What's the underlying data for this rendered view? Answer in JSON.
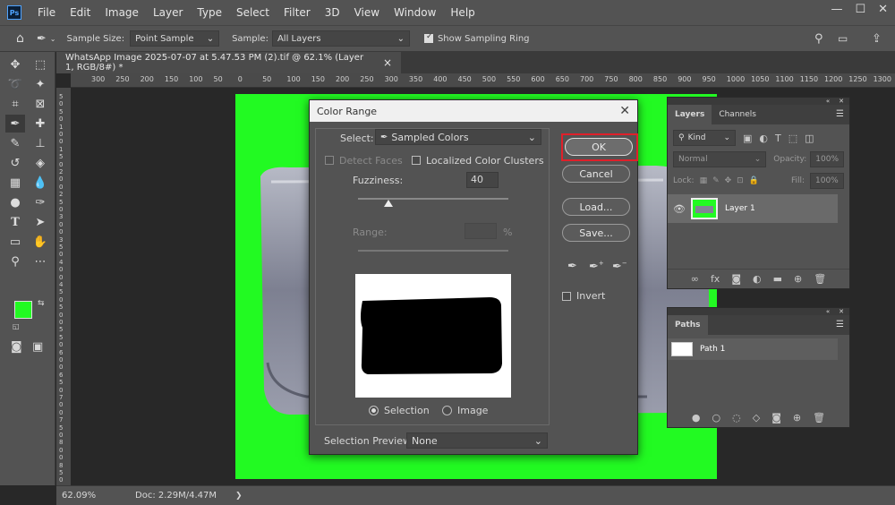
{
  "menubar": {
    "logo": "Ps",
    "items": [
      "File",
      "Edit",
      "Image",
      "Layer",
      "Type",
      "Select",
      "Filter",
      "3D",
      "View",
      "Window",
      "Help"
    ],
    "win_min": "—",
    "win_max": "☐",
    "win_close": "✕"
  },
  "options": {
    "sample_size_label": "Sample Size:",
    "sample_size_value": "Point Sample",
    "sample_label": "Sample:",
    "sample_value": "All Layers",
    "show_ring_label": "Show Sampling Ring"
  },
  "doc": {
    "tab_title": "WhatsApp Image 2025-07-07 at 5.47.53 PM (2).tif @ 62.1% (Layer 1, RGB/8#) *",
    "tab_close": "×"
  },
  "ruler": {
    "top": [
      "300",
      "250",
      "200",
      "150",
      "100",
      "50",
      "0",
      "50",
      "100",
      "150",
      "200",
      "250",
      "300",
      "350",
      "400",
      "450",
      "500",
      "550",
      "600",
      "650",
      "700",
      "750",
      "800",
      "850",
      "900",
      "950",
      "1000",
      "1050",
      "1100",
      "1150",
      "1200",
      "1250",
      "1300"
    ],
    "left": [
      "5",
      "0",
      "5",
      "0",
      "1",
      "0",
      "0",
      "1",
      "5",
      "0",
      "2",
      "0",
      "0",
      "2",
      "5",
      "0",
      "3",
      "0",
      "0",
      "3",
      "5",
      "0",
      "4",
      "0",
      "0",
      "4",
      "5",
      "0",
      "5",
      "0",
      "0",
      "5",
      "5",
      "0",
      "6",
      "0",
      "0",
      "6",
      "5",
      "0",
      "7",
      "0",
      "0",
      "7",
      "5",
      "0",
      "8",
      "0",
      "0",
      "8",
      "5",
      "0"
    ]
  },
  "status": {
    "zoom": "62.09%",
    "doc": "Doc: 2.29M/4.47M",
    "arrow": "❯"
  },
  "dialog": {
    "title": "Color Range",
    "close": "✕",
    "select_label": "Select:",
    "select_value": "Sampled Colors",
    "detect_faces": "Detect Faces",
    "localized": "Localized Color Clusters",
    "fuzziness_label": "Fuzziness:",
    "fuzziness_value": "40",
    "fuzziness_pct": 0.2,
    "range_label": "Range:",
    "range_unit": "%",
    "radio_selection": "Selection",
    "radio_image": "Image",
    "preview_label": "Selection Preview:",
    "preview_value": "None",
    "ok": "OK",
    "cancel": "Cancel",
    "load": "Load...",
    "save": "Save...",
    "invert": "Invert"
  },
  "layers_panel": {
    "tab_layers": "Layers",
    "tab_channels": "Channels",
    "kind": "Kind",
    "blend": "Normal",
    "opacity_label": "Opacity:",
    "opacity_value": "100%",
    "lock_label": "Lock:",
    "fill_label": "Fill:",
    "fill_value": "100%",
    "layer_name": "Layer 1"
  },
  "paths_panel": {
    "tab": "Paths",
    "path_name": "Path 1"
  },
  "colors": {
    "accent_green": "#22fa22",
    "ok_highlight": "#e0202a"
  }
}
